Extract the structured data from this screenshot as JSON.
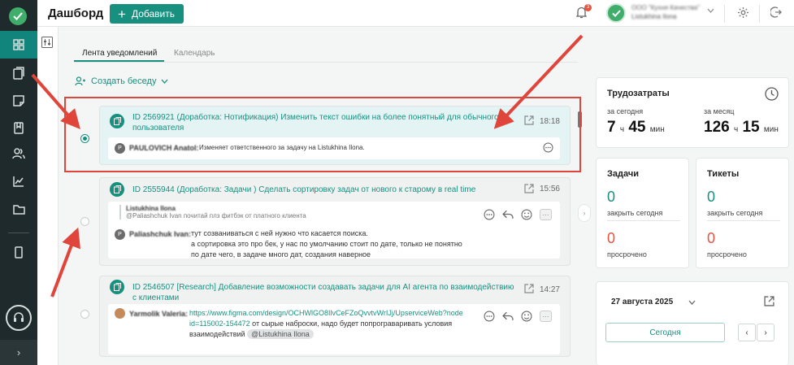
{
  "header": {
    "title": "Дашборд",
    "add_label": "Добавить",
    "notification_count": "3",
    "org_name": "ООО \"Кухня Качества\"",
    "user_name": "Listukhina Ilona"
  },
  "tabs": [
    {
      "label": "Лента уведомлений",
      "active": true
    },
    {
      "label": "Календарь",
      "active": false
    }
  ],
  "create_chat_label": "Создать беседу",
  "feed": [
    {
      "title": "ID 2569921 (Доработка: Нотификация) Изменить текст ошибки на более понятный для обычного пользователя",
      "time": "18:18",
      "selected": true,
      "author": "PAULOVICH Anatol:",
      "author_initial": "P",
      "text": "Изменяет ответственного за задачу на Listukhina Ilona."
    },
    {
      "title": "ID 2555944 (Доработка: Задачи ) Сделать сортировку задач от нового к старому в real time",
      "time": "15:56",
      "selected": false,
      "quote_author": "Listukhina Ilona",
      "quote_text": "@Paliashchuk Ivan почитай плз фитбэк от платного клиента",
      "author": "Paliashchuk Ivan:",
      "author_initial": "P",
      "line1": "тут созваниваться с ней нужно что касается поиска.",
      "line2": "а сортировка это про бек, у нас по умолчанию стоит по дате, только не понятно",
      "line3": "по дате чего, в задаче много дат, создания наверное"
    },
    {
      "title": "ID 2546507 [Research] Добавление возможности создавать задачи для AI агента по взаимодействию с клиентами",
      "time": "14:27",
      "selected": false,
      "author": "Yarmolik Valeria:",
      "link_line1": "https://www.figma.com/design/OCHWlGO8IlvCeFZoQvvtvWrIJj/UpserviceWeb?node",
      "link_line2": "id=115002-154472",
      "line2": " от сырые наброски, надо будет попрограваривать условия",
      "line3": "взаимодействий",
      "mention": "@Listukhina Ilona"
    }
  ],
  "labor": {
    "title": "Трудозатраты",
    "today_label": "за сегодня",
    "month_label": "за месяц",
    "today_h": "7",
    "today_m": "45",
    "month_h": "126",
    "month_m": "15",
    "h_unit": "ч",
    "m_unit": "мин"
  },
  "tasks": {
    "title": "Задачи",
    "close_today_value": "0",
    "close_today_label": "закрыть сегодня",
    "overdue_value": "0",
    "overdue_label": "просрочено"
  },
  "tickets": {
    "title": "Тикеты",
    "close_today_value": "0",
    "close_today_label": "закрыть сегодня",
    "overdue_value": "0",
    "overdue_label": "просрочено"
  },
  "calendar": {
    "date": "27 августа 2025",
    "today_label": "Сегодня"
  },
  "colors": {
    "accent": "#17907f",
    "sidebar": "#1e2a2c",
    "annotation": "#e0453b",
    "overdue": "#e8533f"
  }
}
